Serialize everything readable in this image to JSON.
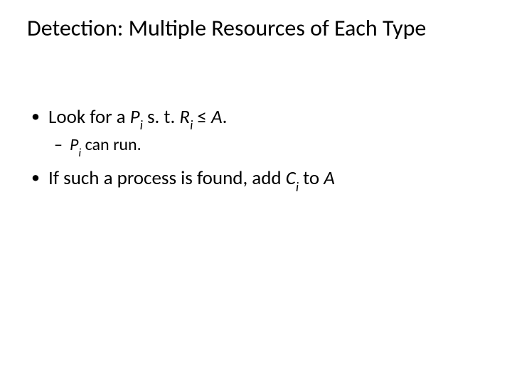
{
  "title": "Detection: Multiple Resources of Each Type",
  "b1": {
    "pre": "Look for a ",
    "P": "P",
    "Pi": "i",
    "mid1": "   s. t.   ",
    "R": "R",
    "Ri": "i",
    "mid2": " ≤ ",
    "A": "A",
    "end": "."
  },
  "b1s": {
    "P": "P",
    "Pi": "i",
    "tail": " can run."
  },
  "b2": {
    "pre": "If such a process is found, add ",
    "C": "C",
    "Ci": "i",
    "mid": " to ",
    "A": "A"
  }
}
